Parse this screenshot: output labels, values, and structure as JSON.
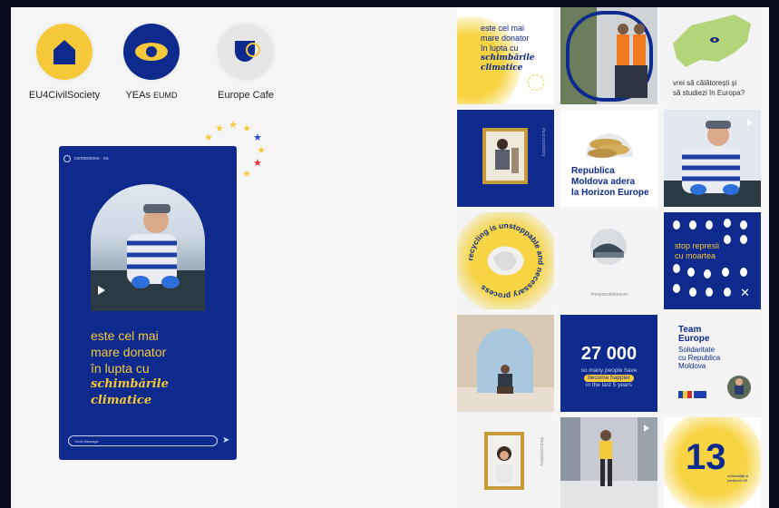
{
  "highlights": [
    {
      "label": "EU4CivilSociety",
      "icon": "house-icon",
      "bg": "#f6c93b",
      "fg": "#0d2a8c"
    },
    {
      "label": "YEAs",
      "label_suffix": "EUMD",
      "icon": "eye-icon",
      "bg": "#0d2a8c",
      "fg": "#f6c93b"
    },
    {
      "label": "Europe Cafe",
      "icon": "cup-icon",
      "bg": "#e6e6e9",
      "fg": "#0d2a8c"
    }
  ],
  "story": {
    "header": "comissiones · eu",
    "line1": "este cel mai",
    "line2": "mare donator",
    "line3": "în lupta cu",
    "line4": "schimbările",
    "line5": "climatice",
    "message_placeholder": "Send Message"
  },
  "grid": {
    "t1": {
      "l1": "este cel mai",
      "l2": "mare donator",
      "l3": "în lupta cu",
      "l4": "schimbările",
      "l5": "climatice"
    },
    "t3": {
      "l1": "vrei să călătorești și",
      "l2": "să studiezi în Europa?"
    },
    "t4": {
      "tag": "#successstory"
    },
    "t5": {
      "l1": "Republica",
      "l2": "Moldova adera",
      "l3": "la Horizon Europe"
    },
    "t7": {
      "ring": "recycling is unstoppable and necessary process"
    },
    "t8": {
      "tag": "#responsibletravel"
    },
    "t9": {
      "l1": "stop represii",
      "l2": "cu moartea"
    },
    "t11": {
      "big": "27 000",
      "s1": "so many people have",
      "s2": "become happier",
      "s3": "in the last 5 years"
    },
    "t12": {
      "l1": "Team",
      "l2": "Europe",
      "l3": "Solidaritate",
      "l4": "cu Republica",
      "l5": "Moldova"
    },
    "t13": {
      "tag": "#successstory"
    },
    "t15": {
      "big": "13",
      "small": "universități și parteneri UE"
    }
  },
  "colors": {
    "navy": "#0d2a8c",
    "yellow": "#f6c93b",
    "background": "#f5f5f6"
  }
}
